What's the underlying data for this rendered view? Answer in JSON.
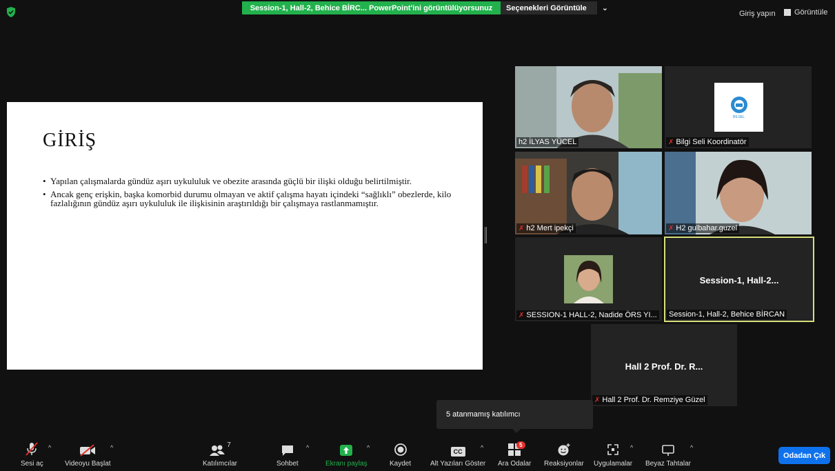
{
  "topbar": {
    "share_banner": "Session-1, Hall-2, Behice BİRC... PowerPoint'ini görüntülüyorsunuz",
    "options_label": "Seçenekleri Görüntüle",
    "options_caret": "⌄",
    "signin": "Giriş yapın",
    "view_label": "Görüntüle"
  },
  "slide": {
    "title": "GİRİŞ",
    "bullets": [
      "Yapılan çalışmalarda gündüz aşırı uykululuk ve obezite arasında güçlü bir ilişki olduğu belirtilmiştir.",
      "Ancak genç erişkin, başka komorbid durumu olmayan ve aktif çalışma hayatı içindeki “sağlıklı” obezlerde, kilo fazlalığının gündüz aşırı uykululuk ile ilişkisinin araştırıldığı bir çalışmaya rastlanmamıştır."
    ]
  },
  "participants": [
    {
      "name": "h2 İLYAS YÜCEL",
      "muted": false
    },
    {
      "name": "Bilgi Seli Koordinatör",
      "muted": true,
      "logo_text": "BİLSEL"
    },
    {
      "name": "h2 Mert ipekçi",
      "muted": true
    },
    {
      "name": "H2 gulbahar.guzel",
      "muted": true
    },
    {
      "name": "SESSION-1 HALL-2, Nadide ÖRS YI...",
      "muted": true
    },
    {
      "name": "Session-1, Hall-2, Behice BİRCAN",
      "muted": false,
      "center_label": "Session-1,  Hall-2..."
    },
    {
      "name": "Hall 2 Prof. Dr. Remziye Güzel",
      "muted": true,
      "center_label": "Hall 2 Prof. Dr. R..."
    }
  ],
  "tooltip": "5 atanmamış katılımcı",
  "toolbar": {
    "unmute": "Sesi aç",
    "start_video": "Videoyu Başlat",
    "participants": "Katılımcılar",
    "participants_count": "7",
    "chat": "Sohbet",
    "share_screen": "Ekranı paylaş",
    "record": "Kaydet",
    "cc_icon_text": "CC",
    "captions": "Alt Yazıları Göster",
    "breakout": "Ara Odalar",
    "breakout_badge": "5",
    "reactions": "Reaksiyonlar",
    "apps": "Uygulamalar",
    "whiteboard": "Beyaz Tahtalar",
    "leave": "Odadan Çık"
  },
  "colors": {
    "share_green": "#22b14c",
    "leave_blue": "#0e72ed",
    "active_border": "#d8e07a",
    "mute_red": "#e0302b"
  }
}
